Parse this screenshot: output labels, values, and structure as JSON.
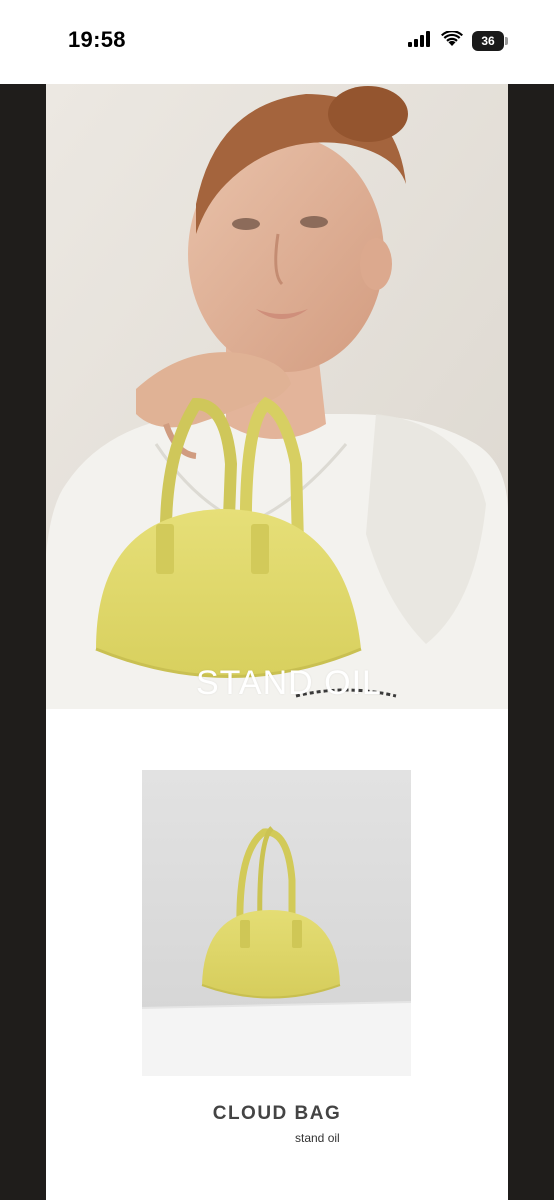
{
  "status_bar": {
    "time": "19:58",
    "battery": "36",
    "icons": [
      "signal-icon",
      "wifi-icon",
      "battery-icon"
    ]
  },
  "hero": {
    "brand": "STAND OIL"
  },
  "product": {
    "title": "CLOUD BAG",
    "subtitle": "stand oil"
  },
  "colors": {
    "bag": "#ded868",
    "frame": "#1f1d1b",
    "hero_background": "#e7e3dd",
    "product_background": "#dedede"
  }
}
